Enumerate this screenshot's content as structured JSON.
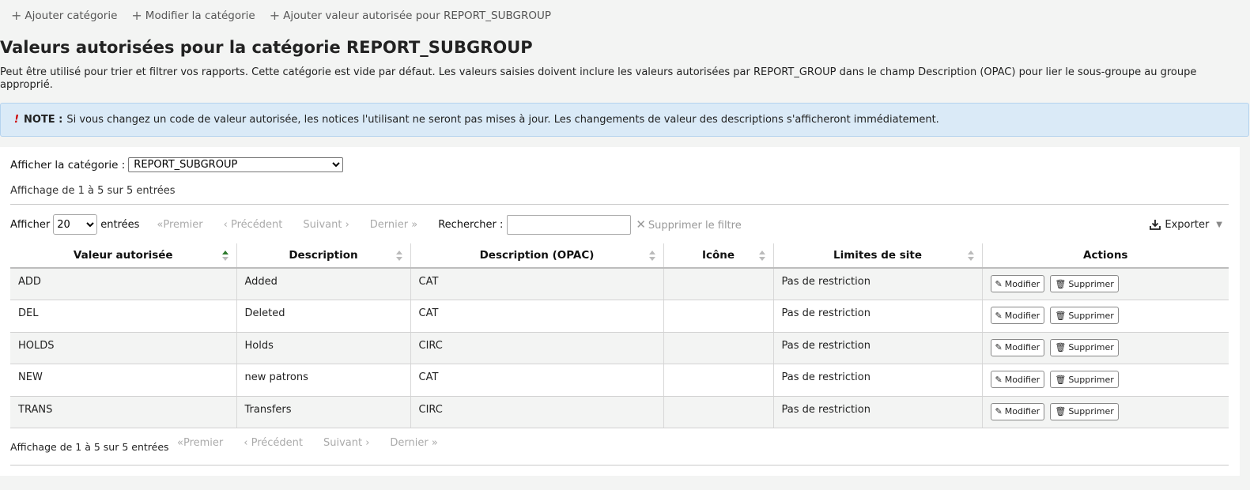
{
  "toolbar": {
    "add_category": "Ajouter catégorie",
    "edit_category": "Modifier la catégorie",
    "add_value": "Ajouter valeur autorisée pour REPORT_SUBGROUP"
  },
  "page_title": "Valeurs autorisées pour la catégorie REPORT_SUBGROUP",
  "description": "Peut être utilisé pour trier et filtrer vos rapports. Cette catégorie est vide par défaut. Les valeurs saisies doivent inclure les valeurs autorisées par REPORT_GROUP dans le champ Description (OPAC) pour lier le sous-groupe au groupe approprié.",
  "note": {
    "mark": "!",
    "label": "NOTE :",
    "text": "Si vous changez un code de valeur autorisée, les notices l'utilisant ne seront pas mises à jour. Les changements de valeur des descriptions s'afficheront immédiatement."
  },
  "category_filter": {
    "label": "Afficher la catégorie :",
    "selected": "REPORT_SUBGROUP"
  },
  "info_top": "Affichage de 1 à 5 sur 5 entrées",
  "info_bottom": "Affichage de 1 à 5 sur 5 entrées",
  "length_menu": {
    "label_before": "Afficher",
    "selected": "20",
    "label_after": "entrées"
  },
  "pager": {
    "first": "«Premier",
    "previous": "‹ Précédent",
    "next": "Suivant ›",
    "last": "Dernier »"
  },
  "search": {
    "label": "Rechercher :",
    "value": ""
  },
  "clear_filter": "Supprimer le filtre",
  "export": "Exporter",
  "columns": [
    "Valeur autorisée",
    "Description",
    "Description (OPAC)",
    "Icône",
    "Limites de site",
    "Actions"
  ],
  "rows": [
    {
      "value": "ADD",
      "description": "Added",
      "opac": "CAT",
      "icon": "",
      "limits": "Pas de restriction"
    },
    {
      "value": "DEL",
      "description": "Deleted",
      "opac": "CAT",
      "icon": "",
      "limits": "Pas de restriction"
    },
    {
      "value": "HOLDS",
      "description": "Holds",
      "opac": "CIRC",
      "icon": "",
      "limits": "Pas de restriction"
    },
    {
      "value": "NEW",
      "description": "new patrons",
      "opac": "CAT",
      "icon": "",
      "limits": "Pas de restriction"
    },
    {
      "value": "TRANS",
      "description": "Transfers",
      "opac": "CIRC",
      "icon": "",
      "limits": "Pas de restriction"
    }
  ],
  "actions": {
    "edit": "Modifier",
    "delete": "Supprimer"
  },
  "icons": {
    "edit": "pencil-icon",
    "delete": "trash-icon",
    "export": "download-icon",
    "add": "plus-icon"
  }
}
